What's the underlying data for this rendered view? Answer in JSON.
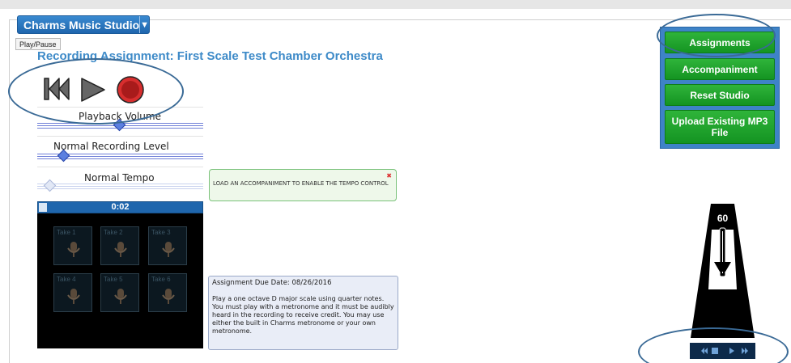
{
  "app": {
    "menu_label": "Charms Music Studio",
    "dropdown_glyph": "▼",
    "tooltip": "Play/Pause"
  },
  "assignment": {
    "title": "Recording Assignment: First Scale Test Chamber Orchestra",
    "due_date": "Assignment Due Date: 08/26/2016",
    "instructions": "Play a one octave D major scale using quarter notes. You must play with a metronome and it must be audibly heard in the recording to receive credit. You may use either the built in Charms metronome or your own metronome."
  },
  "transport": {
    "icons": [
      "rewind-to-start-icon",
      "play-icon",
      "record-icon"
    ]
  },
  "sliders": {
    "playback_volume": {
      "label": "Playback Volume",
      "level": 0.5
    },
    "recording_level": {
      "label": "Normal Recording Level",
      "level": 0.14
    },
    "tempo": {
      "label": "Normal Tempo",
      "level": 0.05,
      "enabled": false
    }
  },
  "tempo_notice": {
    "text": "LOAD AN ACCOMPANIMENT TO ENABLE THE TEMPO CONTROL",
    "close_glyph": "✖"
  },
  "recording": {
    "elapsed": "0:02",
    "progress": 0.05,
    "takes": [
      "Take 1",
      "Take 2",
      "Take 3",
      "Take 4",
      "Take 5",
      "Take 6"
    ]
  },
  "actions": {
    "assignments": "Assignments",
    "accompaniment": "Accompaniment",
    "reset": "Reset Studio",
    "upload": "Upload Existing MP3 File"
  },
  "metronome": {
    "bpm": "60",
    "controls": [
      "rewind-icon",
      "stop-icon",
      "play-icon",
      "fast-forward-icon"
    ]
  },
  "colors": {
    "title_blue": "#3d8ac8",
    "menu_blue": "#1f66ad",
    "action_green": "#149422",
    "panel_blue": "#3e83c7",
    "record_red": "#c62828",
    "annotation_oval": "#3a6a96"
  }
}
